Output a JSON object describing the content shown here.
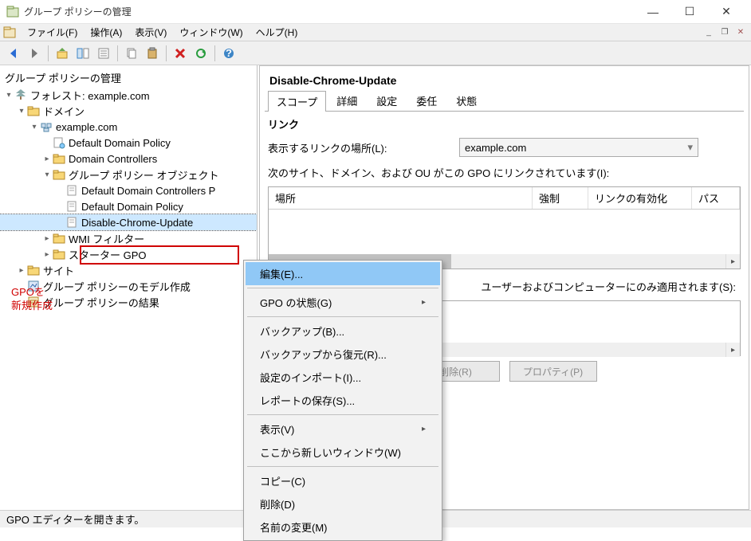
{
  "window": {
    "title": "グループ ポリシーの管理"
  },
  "menu": {
    "file": "ファイル(F)",
    "action": "操作(A)",
    "view": "表示(V)",
    "window": "ウィンドウ(W)",
    "help": "ヘルプ(H)"
  },
  "annotation": {
    "line1": "GPOを",
    "line2": "新規作成"
  },
  "tree": {
    "root": "グループ ポリシーの管理",
    "forest": "フォレスト: example.com",
    "domains": "ドメイン",
    "domain": "example.com",
    "ddp": "Default Domain Policy",
    "dc": "Domain Controllers",
    "gpoFolder": "グループ ポリシー オブジェクト",
    "ddcp": "Default Domain Controllers P",
    "ddp2": "Default Domain Policy",
    "selected": "Disable-Chrome-Update",
    "wmi": "WMI フィルター",
    "starter": "スターター GPO",
    "sites": "サイト",
    "modeling": "グループ ポリシーのモデル作成",
    "results": "グループ ポリシーの結果"
  },
  "right": {
    "title": "Disable-Chrome-Update",
    "tabs": {
      "scope": "スコープ",
      "detail": "詳細",
      "settings": "設定",
      "delegation": "委任",
      "status": "状態"
    },
    "linkSection": "リンク",
    "linkLocLabel": "表示するリンクの場所(L):",
    "linkLocValue": "example.com",
    "linkCaption": "次のサイト、ドメイン、および OU がこの GPO にリンクされています(I):",
    "gridHead": {
      "loc": "場所",
      "force": "強制",
      "link": "リンクの有効化",
      "path": "パス"
    },
    "filterCaption": "ユーザーおよびコンピューターにのみ適用されます(S):",
    "btnDelete": "削除(R)",
    "btnProps": "プロパティ(P)"
  },
  "contextMenu": {
    "edit": "編集(E)...",
    "gpoStatus": "GPO の状態(G)",
    "backup": "バックアップ(B)...",
    "restore": "バックアップから復元(R)...",
    "import": "設定のインポート(I)...",
    "saveReport": "レポートの保存(S)...",
    "view": "表示(V)",
    "newWindow": "ここから新しいウィンドウ(W)",
    "copy": "コピー(C)",
    "delete": "削除(D)",
    "rename": "名前の変更(M)"
  },
  "status": "GPO エディターを開きます。"
}
